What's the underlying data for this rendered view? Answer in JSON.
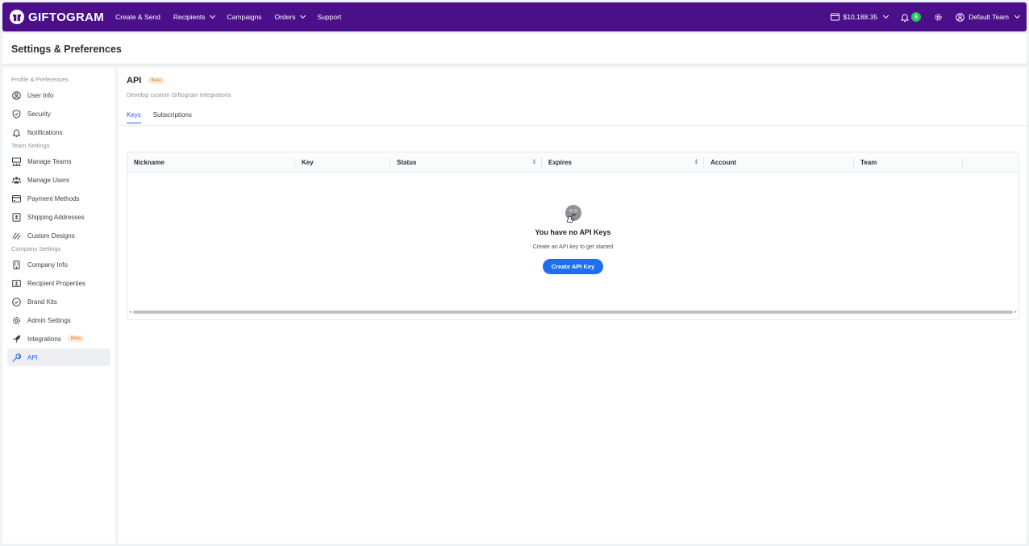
{
  "brand": {
    "name": "GIFTOGRAM"
  },
  "nav": {
    "items": [
      {
        "label": "Create & Send",
        "dropdown": false
      },
      {
        "label": "Recipients",
        "dropdown": true
      },
      {
        "label": "Campaigns",
        "dropdown": false
      },
      {
        "label": "Orders",
        "dropdown": true
      },
      {
        "label": "Support",
        "dropdown": false
      }
    ],
    "balance": "$10,188.35",
    "notification_count": "6",
    "team": "Default Team"
  },
  "page": {
    "title": "Settings & Preferences"
  },
  "sidebar": {
    "sections": [
      {
        "title": "Profile & Preferences",
        "items": [
          {
            "label": "User Info",
            "icon": "user-circle-icon"
          },
          {
            "label": "Security",
            "icon": "shield-icon"
          },
          {
            "label": "Notifications",
            "icon": "bell-icon"
          }
        ]
      },
      {
        "title": "Team Settings",
        "items": [
          {
            "label": "Manage Teams",
            "icon": "teams-icon"
          },
          {
            "label": "Manage Users",
            "icon": "users-icon"
          },
          {
            "label": "Payment Methods",
            "icon": "credit-card-icon"
          },
          {
            "label": "Shipping Addresses",
            "icon": "address-icon"
          },
          {
            "label": "Custom Designs",
            "icon": "design-icon"
          }
        ]
      },
      {
        "title": "Company Settings",
        "items": [
          {
            "label": "Company Info",
            "icon": "building-icon"
          },
          {
            "label": "Recipient Properties",
            "icon": "recipient-icon"
          },
          {
            "label": "Brand Kits",
            "icon": "check-circle-icon"
          },
          {
            "label": "Admin Settings",
            "icon": "gear-icon"
          },
          {
            "label": "Integrations",
            "icon": "rocket-icon",
            "badge": "Beta"
          },
          {
            "label": "API",
            "icon": "wrench-icon",
            "active": true
          }
        ]
      }
    ]
  },
  "main": {
    "title": "API",
    "badge": "Beta",
    "subtitle": "Develop custom Giftogram integrations",
    "tabs": [
      {
        "label": "Keys",
        "active": true
      },
      {
        "label": "Subscriptions",
        "active": false
      }
    ],
    "table": {
      "columns": [
        {
          "label": "Nickname",
          "sortable": false
        },
        {
          "label": "Key",
          "sortable": false
        },
        {
          "label": "Status",
          "sortable": true
        },
        {
          "label": "Expires",
          "sortable": true
        },
        {
          "label": "Account",
          "sortable": false
        },
        {
          "label": "Team",
          "sortable": false
        }
      ],
      "empty_title": "You have no API Keys",
      "empty_subtitle": "Create an API key to get started",
      "create_button": "Create API Key"
    }
  },
  "colors": {
    "nav_bg": "#4b0f8a",
    "accent": "#1d6ff2",
    "beta_bg": "#fdebd9",
    "beta_text": "#e07a26"
  }
}
